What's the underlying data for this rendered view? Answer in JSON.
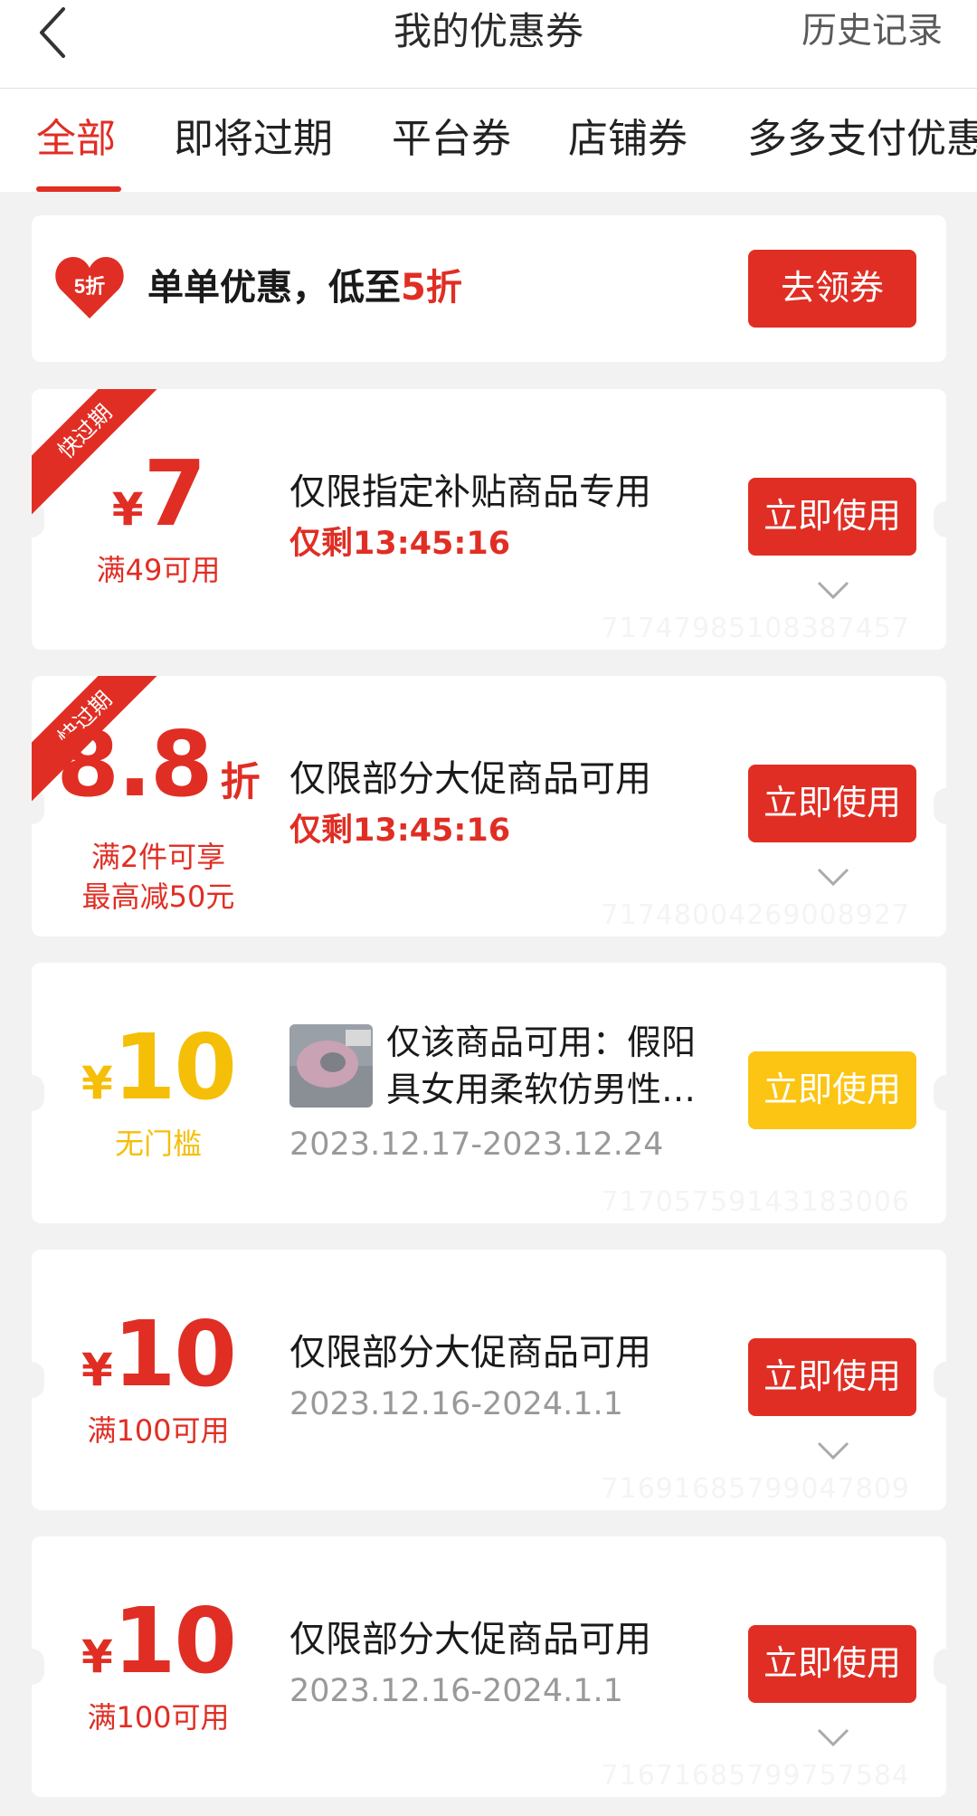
{
  "header": {
    "title": "我的优惠券",
    "history": "历史记录"
  },
  "tabs": [
    {
      "label": "全部",
      "active": true
    },
    {
      "label": "即将过期"
    },
    {
      "label": "平台券"
    },
    {
      "label": "店铺券"
    },
    {
      "label": "多多支付优惠"
    }
  ],
  "promo": {
    "badge": "5折",
    "text_main": "单单优惠，低至",
    "text_highlight": "5折",
    "button": "去领券"
  },
  "coupons": [
    {
      "ribbon": "快过期",
      "currency": "¥",
      "amount": "7",
      "condition": "满49可用",
      "title": "仅限指定补贴商品专用",
      "subtitle": "仅剩13:45:16",
      "button": "立即使用",
      "code": "71747985108387457"
    },
    {
      "ribbon": "快过期",
      "amount": "8.8",
      "unit": "折",
      "condition_1": "满2件可享",
      "condition_2": "最高减50元",
      "title": "仅限部分大促商品可用",
      "subtitle": "仅剩13:45:16",
      "button": "立即使用",
      "code": "71748004269008927"
    },
    {
      "currency": "¥",
      "amount": "10",
      "condition": "无门槛",
      "title": "仅该商品可用：假阳具女用柔软仿男性…",
      "subtitle": "2023.12.17-2023.12.24",
      "button": "立即使用",
      "code": "71705759143183006"
    },
    {
      "currency": "¥",
      "amount": "10",
      "condition": "满100可用",
      "title": "仅限部分大促商品可用",
      "subtitle": "2023.12.16-2024.1.1",
      "button": "立即使用",
      "code": "71691685799047809"
    },
    {
      "currency": "¥",
      "amount": "10",
      "condition": "满100可用",
      "title": "仅限部分大促商品可用",
      "subtitle": "2023.12.16-2024.1.1",
      "button": "立即使用",
      "code": "71671685799757584"
    }
  ],
  "colors": {
    "accent": "#e02e24",
    "yellow": "#f5bf08",
    "bg": "#f2f2f2"
  }
}
